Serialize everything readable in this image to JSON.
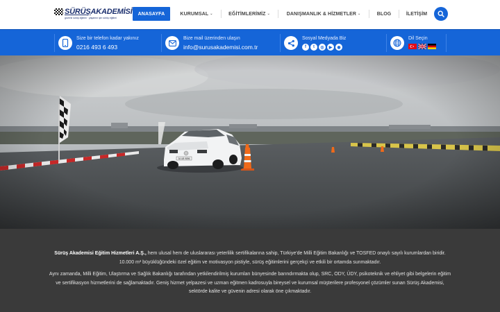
{
  "logo": {
    "name_part1": "SÜRÜŞ",
    "name_part2": "AKADEMİSİ",
    "tagline": "güvenli sürüş eğitimi · yaşamın için sürüş eğitimi"
  },
  "nav": {
    "items": [
      {
        "label": "ANASAYFA",
        "active": true,
        "has_dropdown": false
      },
      {
        "label": "KURUMSAL",
        "active": false,
        "has_dropdown": true
      },
      {
        "label": "EĞİTİMLERİMİZ",
        "active": false,
        "has_dropdown": true
      },
      {
        "label": "DANIŞMANLIK & HİZMETLER",
        "active": false,
        "has_dropdown": true
      },
      {
        "label": "BLOG",
        "active": false,
        "has_dropdown": false
      },
      {
        "label": "İLETİŞİM",
        "active": false,
        "has_dropdown": false
      }
    ],
    "dropdown_caret": "⌄",
    "search_icon": "search-icon"
  },
  "infobar": {
    "phone": {
      "label": "Size bir telefon kadar yakınız",
      "value": "0216 493 6 493",
      "icon": "phone-icon"
    },
    "mail": {
      "label": "Bize mail üzerinden ulaşın",
      "value": "info@surusakademisi.com.tr",
      "icon": "envelope-icon"
    },
    "social": {
      "label": "Sosyal Medyada Biz",
      "icon": "share-icon",
      "links": [
        {
          "name": "facebook-icon",
          "glyph": "f"
        },
        {
          "name": "twitter-icon",
          "glyph": "t"
        },
        {
          "name": "instagram-icon",
          "glyph": "◎"
        },
        {
          "name": "youtube-icon",
          "glyph": "▶"
        },
        {
          "name": "rss-icon",
          "glyph": "◉"
        }
      ]
    },
    "language": {
      "label": "Dil Seçin",
      "icon": "globe-icon",
      "options": [
        "Türkçe",
        "English",
        "Deutsch"
      ]
    }
  },
  "hero": {
    "plate": "34 UB 9896"
  },
  "about": {
    "company": "Sürüş Akademisi Eğitim Hizmetleri A.Ş.,",
    "p1_rest": " hem ulusal hem de uluslararası yeterlilik sertifikalarına sahip, Türkiye'de Milli Eğitim Bakanlığı ve TOSFED onaylı sayılı kurumlardan biridir. 10.000 m² büyüklüğündeki özel eğitim ve motivasyon pistiyle, sürüş eğitimlerini gerçekçi ve etkili bir ortamda sunmaktadır.",
    "p2": "Aynı zamanda, Milli Eğitim, Ulaştırma ve Sağlık Bakanlığı tarafından yetkilendirilmiş kurumları bünyesinde barındırmakta olup, SRC, ODY, ÜDY, psikoteknik ve ehliyet gibi belgelerin eğitim ve sertifikasyon hizmetlerini de sağlamaktadır. Geniş hizmet yelpazesi ve uzman eğitmen kadrosuyla bireysel ve kurumsal müşterilere profesyonel çözümler sunan Sürüş Akademisi, sektörde kalite ve güvenin adresi olarak öne çıkmaktadır."
  },
  "colors": {
    "brand_blue": "#1565d8",
    "logo_navy": "#1b2f6e",
    "footer_bg": "#3a3a3a"
  }
}
